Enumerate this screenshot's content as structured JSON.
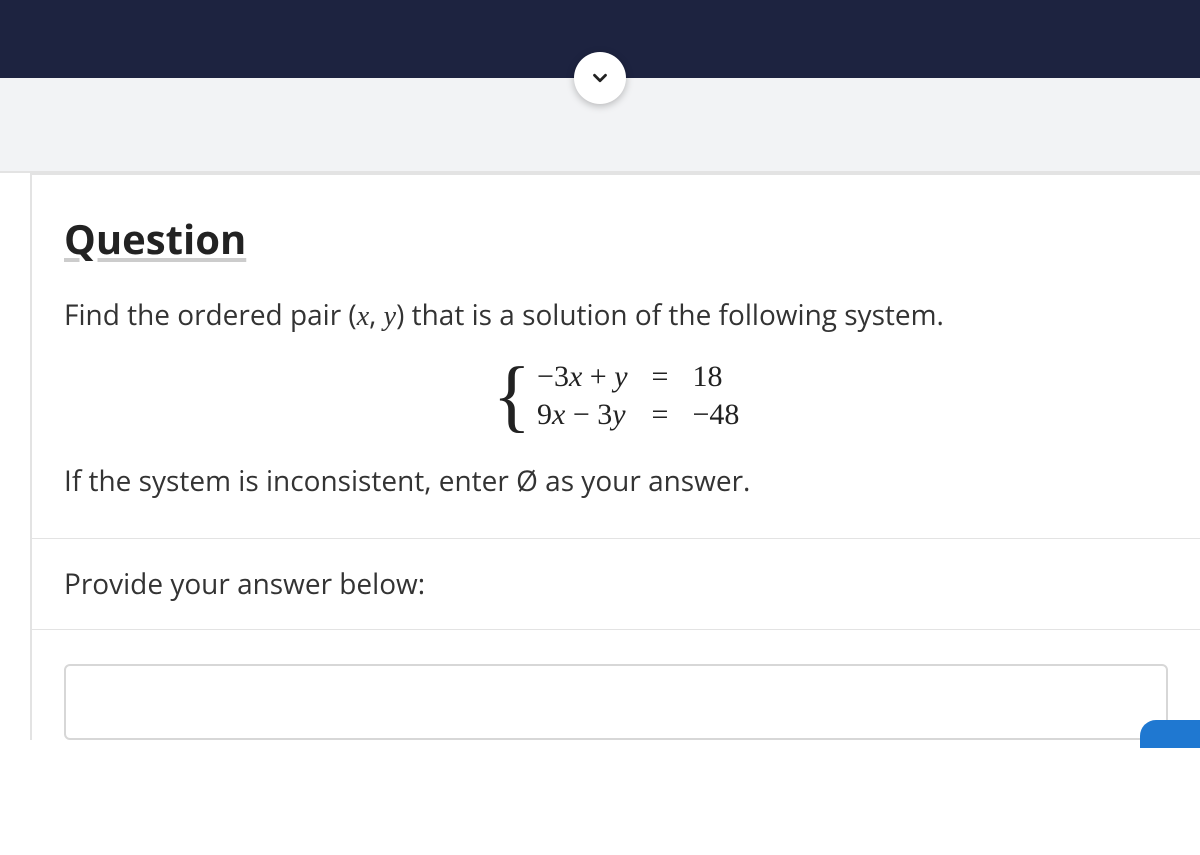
{
  "header": {
    "chevron_icon": "chevron-down"
  },
  "question": {
    "heading": "Question",
    "prompt_before": "Find the ordered pair (",
    "var_x": "x",
    "prompt_sep": ", ",
    "var_y": "y",
    "prompt_after": ") that is a solution of the following system.",
    "equations": {
      "row1": {
        "lhs": "−3x + y",
        "eq": "=",
        "rhs": "18"
      },
      "row2": {
        "lhs": "9x − 3y",
        "eq": "=",
        "rhs": "−48"
      }
    },
    "note_before": "If the system is inconsistent, enter ",
    "empty_set": "Ø",
    "note_after": " as your answer.",
    "answer_label": "Provide your answer below:",
    "answer_value": ""
  }
}
